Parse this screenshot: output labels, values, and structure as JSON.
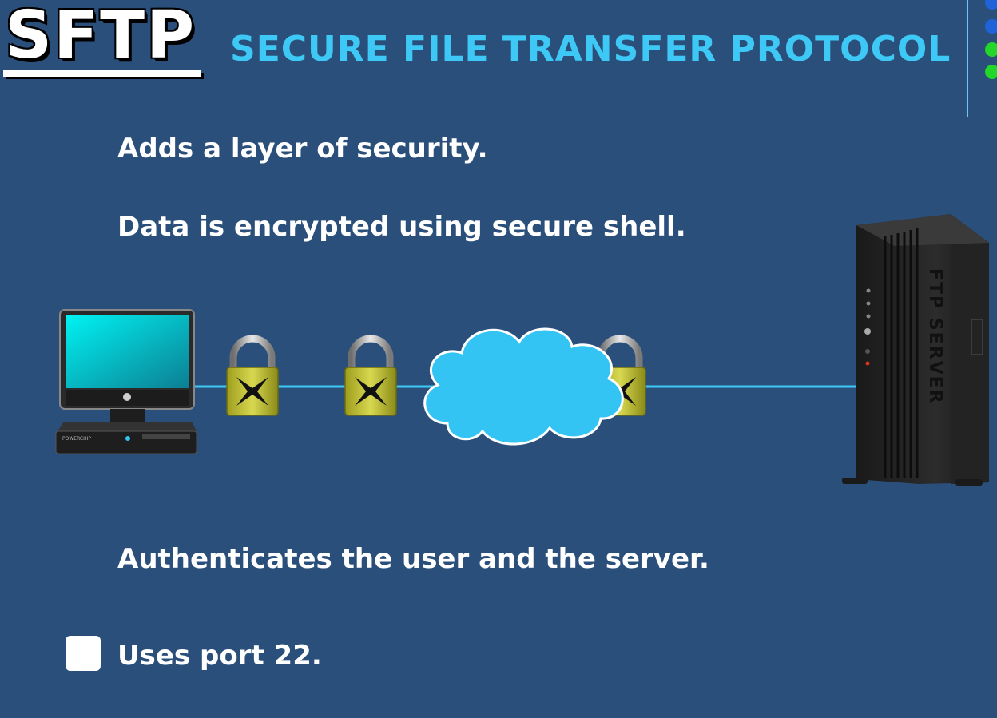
{
  "header": {
    "logo_text": "SFTP",
    "title": "SECURE FILE TRANSFER PROTOCOL"
  },
  "bullets": {
    "line1": "Adds a layer of security.",
    "line2": "Data is encrypted using secure shell.",
    "line3": "Authenticates the user and the server.",
    "line4": "Uses port 22."
  },
  "diagram": {
    "server_label": "FTP SERVER",
    "computer_brand": "POWERCHIP"
  },
  "colors": {
    "background": "#2b4f7b",
    "accent": "#3ec8f5",
    "lock": "#c8c83a",
    "cloud": "#33c4f3"
  },
  "indicators": {
    "dots": [
      "#1f63d8",
      "#1f63d8",
      "#22d62a",
      "#22d62a"
    ]
  }
}
